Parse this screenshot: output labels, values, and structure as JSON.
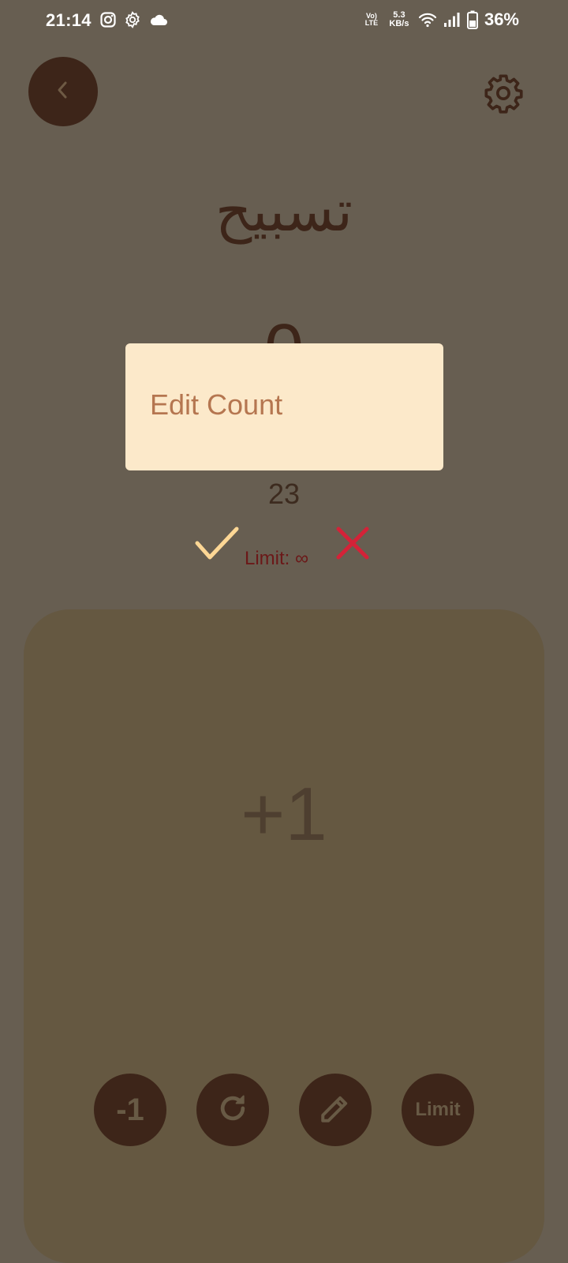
{
  "status_bar": {
    "time": "21:14",
    "volte_top": "Vo)",
    "volte_bottom": "LTE",
    "net_speed_value": "5.3",
    "net_speed_unit": "KB/s",
    "battery_percent": "36%",
    "icons": [
      "instagram-icon",
      "gear-icon",
      "cloud-icon",
      "wifi-icon",
      "signal-icon",
      "battery-icon"
    ]
  },
  "header": {
    "title": "تسبيح",
    "back_icon": "chevron-left-icon",
    "settings_icon": "gear-icon"
  },
  "counter": {
    "value": "0",
    "tap_label": "+1"
  },
  "edit_dialog": {
    "title": "Edit Count",
    "value": "23"
  },
  "limit": {
    "text": "Limit: ∞"
  },
  "actions": {
    "decrement_label": "-1",
    "reset_icon": "refresh-icon",
    "edit_icon": "pencil-icon",
    "limit_label": "Limit"
  },
  "colors": {
    "background": "#675e51",
    "panel": "#655841",
    "button": "#3d2519",
    "dialog": "#fce9ca",
    "dialog_title": "#b57650",
    "confirm": "#fdd795",
    "cancel": "#d42238"
  }
}
